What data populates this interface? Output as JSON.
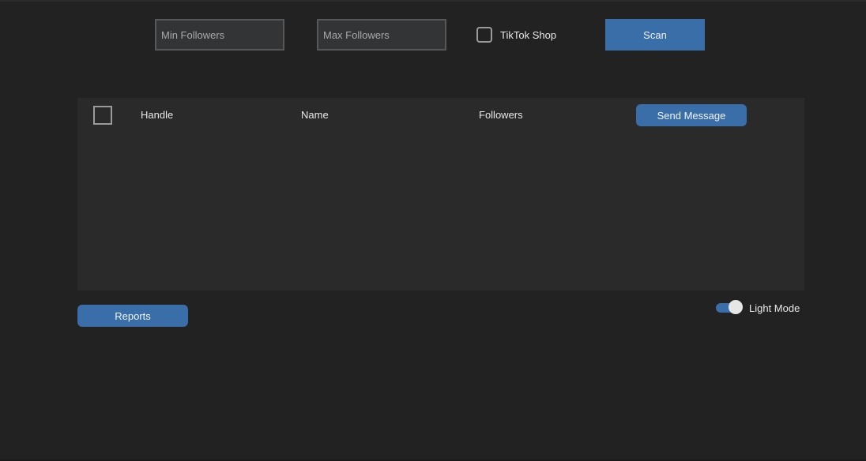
{
  "filters": {
    "min_followers_placeholder": "Min Followers",
    "min_followers_value": "",
    "max_followers_placeholder": "Max Followers",
    "max_followers_value": "",
    "tiktok_shop_label": "TikTok Shop",
    "tiktok_shop_checked": false,
    "scan_label": "Scan"
  },
  "table": {
    "columns": [
      "Handle",
      "Name",
      "Followers"
    ],
    "select_all_checked": false,
    "send_message_label": "Send Message",
    "rows": []
  },
  "footer": {
    "reports_label": "Reports",
    "light_mode_label": "Light Mode",
    "light_mode_on": true
  },
  "colors": {
    "background": "#222222",
    "panel": "#2a2a2a",
    "input_bg": "#333436",
    "accent": "#3a6ea8",
    "text": "#e8e8e8"
  }
}
